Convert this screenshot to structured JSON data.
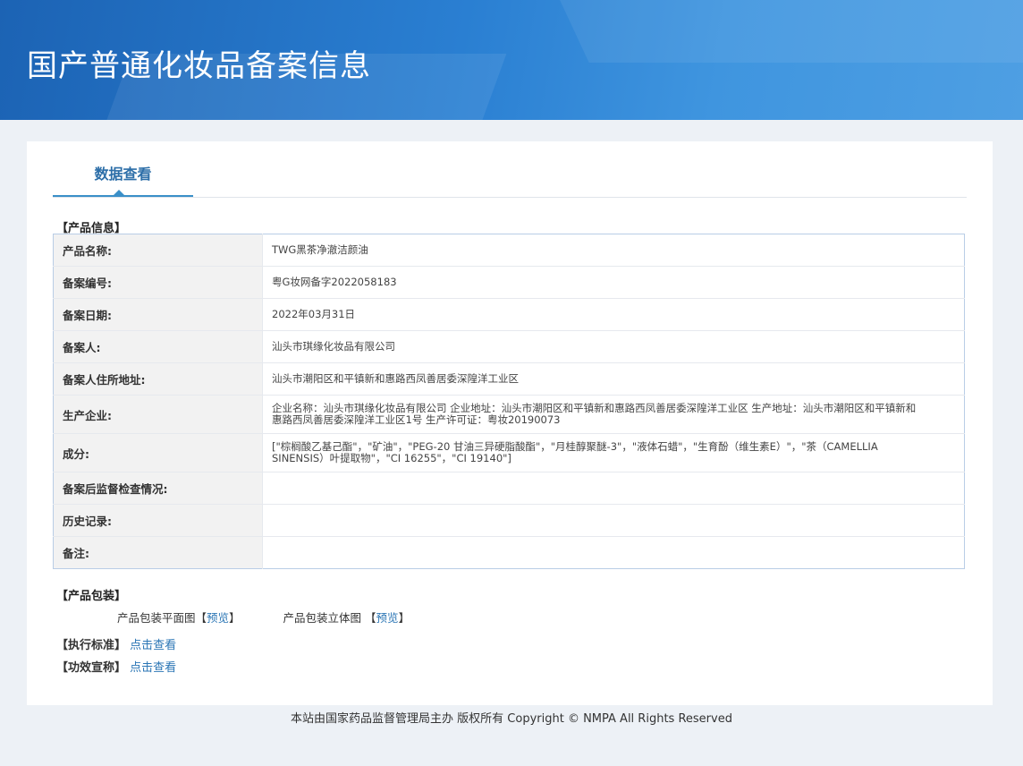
{
  "header": {
    "title": "国产普通化妆品备案信息"
  },
  "tabs": [
    {
      "label": "数据查看"
    }
  ],
  "product_info": {
    "section_title": "【产品信息】",
    "rows": [
      {
        "label": "产品名称:",
        "value": "TWG黑茶净澈洁颜油"
      },
      {
        "label": "备案编号:",
        "value": "粤G妆网备字2022058183"
      },
      {
        "label": "备案日期:",
        "value": "2022年03月31日"
      },
      {
        "label": "备案人:",
        "value": "汕头市琪缘化妆品有限公司"
      },
      {
        "label": "备案人住所地址:",
        "value": "汕头市潮阳区和平镇新和惠路西凤善居委深隍洋工业区"
      },
      {
        "label": "生产企业:",
        "value": "企业名称：汕头市琪缘化妆品有限公司 企业地址：汕头市潮阳区和平镇新和惠路西凤善居委深隍洋工业区 生产地址：汕头市潮阳区和平镇新和惠路西凤善居委深隍洋工业区1号 生产许可证：粤妆20190073"
      },
      {
        "label": "成分:",
        "value": "[\"棕榈酸乙基己酯\"，\"矿油\"，\"PEG-20 甘油三异硬脂酸酯\"，\"月桂醇聚醚-3\"，\"液体石蜡\"，\"生育酚（维生素E）\"，\"茶（CAMELLIA SINENSIS）叶提取物\"，\"CI 16255\"，\"CI 19140\"]"
      },
      {
        "label": "备案后监督检查情况:",
        "value": ""
      },
      {
        "label": "历史记录:",
        "value": ""
      },
      {
        "label": "备注:",
        "value": ""
      }
    ]
  },
  "packaging": {
    "section_title": "【产品包装】",
    "flat_label": "产品包装平面图",
    "solid_label": "产品包装立体图",
    "preview_link": "预览",
    "bracket_open": "【",
    "bracket_close": "】"
  },
  "standard": {
    "label": "【执行标准】",
    "link": "点击查看"
  },
  "efficacy": {
    "label": "【功效宣称】",
    "link": "点击查看"
  },
  "footer": {
    "text": "本站由国家药品监督管理局主办 版权所有 Copyright © NMPA All Rights Reserved"
  }
}
